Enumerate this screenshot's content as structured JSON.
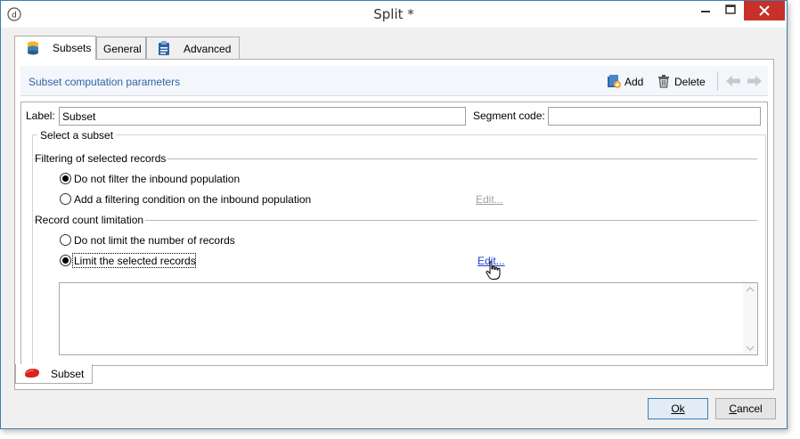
{
  "window": {
    "title": "Split *"
  },
  "tabs": [
    {
      "label": "Subsets",
      "icon": "database-icon",
      "active": true
    },
    {
      "label": "General",
      "active": false
    },
    {
      "label": "Advanced",
      "icon": "clipboard-icon",
      "active": false
    }
  ],
  "header": {
    "title": "Subset computation parameters",
    "add_label": "Add",
    "delete_label": "Delete"
  },
  "form": {
    "label_caption": "Label:",
    "label_value": "Subset",
    "segment_caption": "Segment code:",
    "segment_value": "",
    "group_title": "Select a subset",
    "filtering": {
      "title": "Filtering of selected records",
      "options": [
        {
          "label": "Do not filter the inbound population",
          "checked": true
        },
        {
          "label": "Add a filtering condition on the inbound population",
          "checked": false
        }
      ],
      "edit_label": "Edit..."
    },
    "limitation": {
      "title": "Record count limitation",
      "options": [
        {
          "label": "Do not limit the number of records",
          "checked": false
        },
        {
          "label": "Limit the selected records",
          "checked": true
        }
      ],
      "edit_label": "Edit..."
    }
  },
  "bottom_tab": {
    "label": "Subset"
  },
  "buttons": {
    "ok": "Ok",
    "cancel": "Cancel"
  },
  "colors": {
    "accent": "#2f64a8",
    "close": "#c7302b",
    "link": "#1a3fcf"
  }
}
